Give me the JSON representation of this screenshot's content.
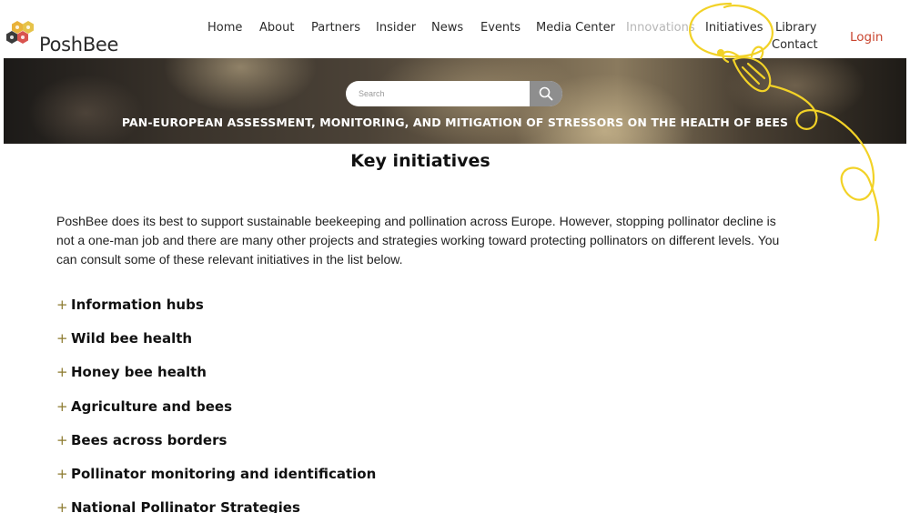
{
  "brand": {
    "name": "PoshBee",
    "hex_colors": [
      "#e9b23a",
      "#e6c34a",
      "#3b3b3b",
      "#d9534f"
    ]
  },
  "nav": {
    "items": [
      {
        "label": "Home"
      },
      {
        "label": "About"
      },
      {
        "label": "Partners"
      },
      {
        "label": "Insider"
      },
      {
        "label": "News"
      },
      {
        "label": "Events"
      },
      {
        "label": "Media Center"
      },
      {
        "label": "Innovations"
      },
      {
        "label": "Initiatives"
      },
      {
        "label": "Library"
      },
      {
        "label": "Contact"
      }
    ],
    "login": "Login"
  },
  "banner": {
    "search_placeholder": "Search",
    "search_icon": "magnifier-icon",
    "tagline": "PAN-EUROPEAN ASSESSMENT, MONITORING, AND MITIGATION OF STRESSORS ON THE HEALTH OF BEES"
  },
  "main": {
    "title": "Key initiatives",
    "intro": "PoshBee does its best to support sustainable beekeeping and pollination across Europe. However, stopping pollinator decline is not a one-man job and there are many other projects and strategies working toward protecting pollinators on different levels. You can consult some of these relevant initiatives in the list below.",
    "accordion": [
      {
        "icon": "+",
        "label": "Information hubs"
      },
      {
        "icon": "+",
        "label": "Wild bee health"
      },
      {
        "icon": "+",
        "label": "Honey bee health"
      },
      {
        "icon": "+",
        "label": "Agriculture and bees"
      },
      {
        "icon": "+",
        "label": "Bees across borders"
      },
      {
        "icon": "+",
        "label": "Pollinator monitoring and identification"
      },
      {
        "icon": "+",
        "label": "National Pollinator Strategies"
      }
    ]
  },
  "colors": {
    "accent_gold": "#8c7a2e",
    "login_red": "#c9452f",
    "muted_nav": "#b7b7b7",
    "doodle_yellow": "#f2d227"
  }
}
